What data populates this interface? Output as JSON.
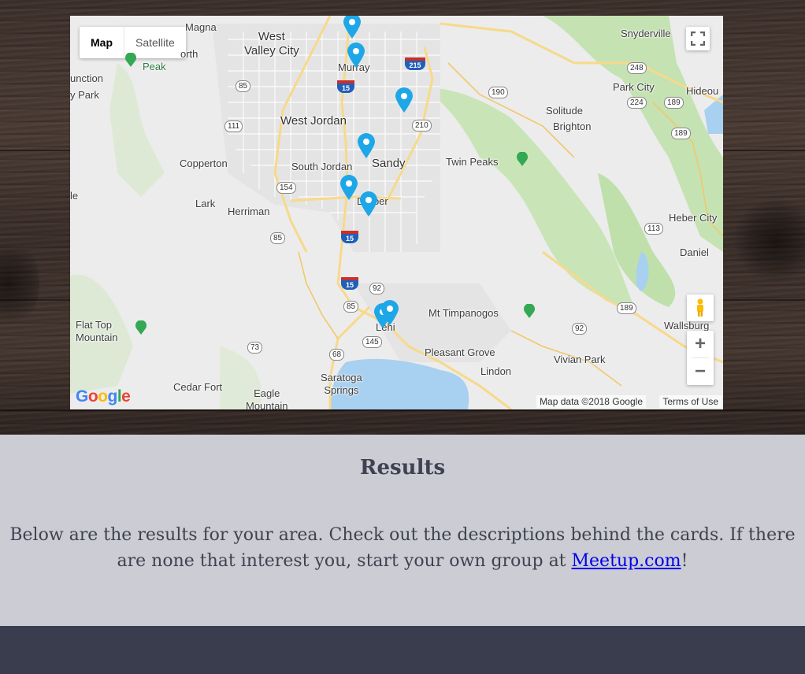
{
  "map": {
    "type_buttons": [
      "Map",
      "Satellite"
    ],
    "active_type": "Map",
    "places": {
      "magna": "Magna",
      "west_valley_city": "West\nValley City",
      "north": "orth",
      "peak": "Peak",
      "junction": "unction",
      "y_park": "y Park",
      "murray": "Murray",
      "snyderville": "Snyderville",
      "park_city": "Park City",
      "hideout": "Hideou",
      "solitude": "Solitude",
      "brighton": "Brighton",
      "west_jordan": "West Jordan",
      "sandy": "Sandy",
      "twin_peaks": "Twin Peaks",
      "copperton": "Copperton",
      "south_jordan": "South Jordan",
      "le": "le",
      "lark": "Lark",
      "herriman": "Herriman",
      "draper": "Draper",
      "heber_city": "Heber City",
      "daniel": "Daniel",
      "mt_timpanogos": "Mt Timpanogos",
      "flat_top_mountain": "Flat Top\nMountain",
      "lehi": "Lehi",
      "wallsburg": "Wallsburg",
      "pleasant_grove": "Pleasant Grove",
      "vivian_park": "Vivian Park",
      "lindon": "Lindon",
      "cedar_fort": "Cedar Fort",
      "eagle_mountain": "Eagle\nMountain",
      "saratoga_springs": "Saratoga\nSprings"
    },
    "routes": {
      "r85a": "85",
      "r111": "111",
      "r154": "154",
      "r85b": "85",
      "r85c": "85",
      "r92a": "92",
      "r145": "145",
      "r68": "68",
      "r73": "73",
      "r190": "190",
      "r210": "210",
      "r248": "248",
      "r224": "224",
      "r189a": "189",
      "r189b": "189",
      "r113": "113",
      "r189c": "189",
      "r92b": "92",
      "i15a": "15",
      "i15b": "15",
      "i15c": "15",
      "i215": "215"
    },
    "footer": {
      "map_data": "Map data ©2018 Google",
      "terms": "Terms of Use"
    },
    "google_logo": "Google",
    "zoom_in": "+",
    "zoom_out": "−"
  },
  "results": {
    "title": "Results",
    "text_before": "Below are the results for your area. Check out the descriptions behind the cards. If there are none that interest you, start your own group at ",
    "link_text": "Meetup.com",
    "text_after": "!"
  },
  "colors": {
    "pin": "#1ea7e8",
    "results_bg": "#ccccd4",
    "footer_bg": "#393d4d",
    "text": "#3f4250",
    "link": "#0000ee"
  }
}
